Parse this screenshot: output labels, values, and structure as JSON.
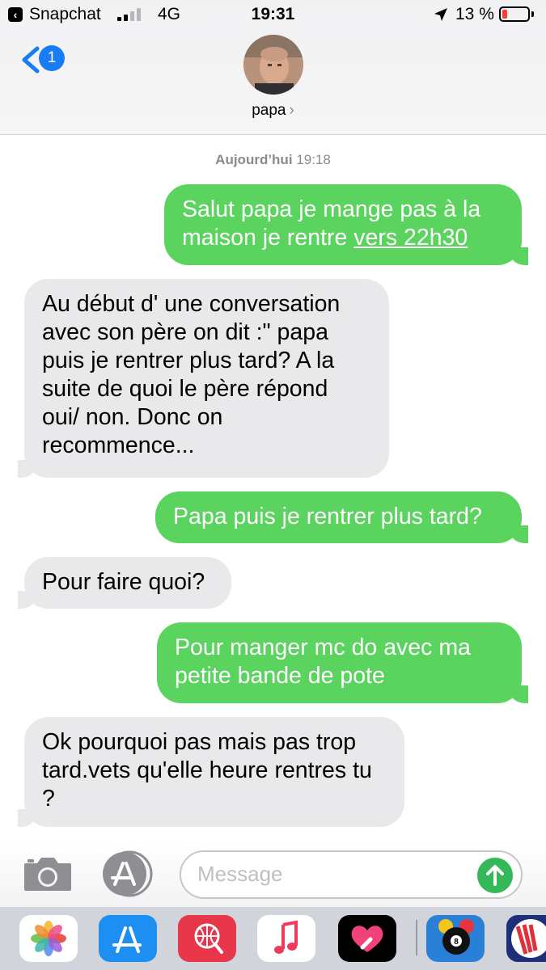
{
  "status_bar": {
    "back_app": "Snapchat",
    "network": "4G",
    "time": "19:31",
    "battery": "13 %",
    "battery_level": 0.13
  },
  "header": {
    "back_badge": "1",
    "contact_name": "papa",
    "chevron": "›"
  },
  "conversation": {
    "date_day": "Aujourd’hui",
    "date_time": "19:18",
    "messages": [
      {
        "side": "out",
        "text_a": "Salut papa je mange pas à la",
        "text_b": "maison je rentre ",
        "link": "vers 22h30"
      },
      {
        "side": "in",
        "text": "Au début d' une conversation avec son père on dit :\" papa puis je rentrer plus tard? A la suite de quoi le père répond oui/ non. Donc on recommence..."
      },
      {
        "side": "out",
        "text": "Papa puis je rentrer plus tard?"
      },
      {
        "side": "in",
        "text": "Pour faire quoi?"
      },
      {
        "side": "out",
        "text": "Pour manger mc do  avec ma petite bande de pote"
      },
      {
        "side": "in",
        "text": "Ok pourquoi pas mais pas trop tard.vets qu'elle heure rentres tu ?"
      }
    ]
  },
  "composer": {
    "placeholder": "Message"
  },
  "app_drawer": [
    {
      "icon": "photos-icon"
    },
    {
      "icon": "app-store-icon"
    },
    {
      "icon": "search-images-icon"
    },
    {
      "icon": "music-icon"
    },
    {
      "icon": "digital-touch-icon"
    },
    {
      "icon": "8-ball-pool-icon"
    },
    {
      "icon": "partial-app-icon"
    }
  ],
  "colors": {
    "outgoing_bubble": "#5ad35f",
    "incoming_bubble": "#e9e9eb",
    "accent_blue": "#1a7cf5",
    "send_button": "#34b85a"
  }
}
